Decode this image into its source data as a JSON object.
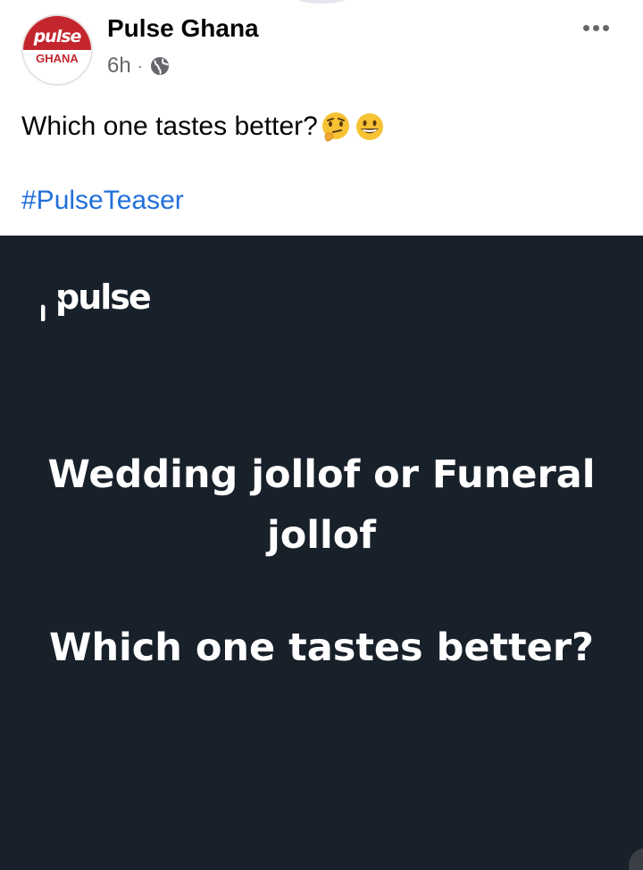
{
  "post": {
    "author": "Pulse Ghana",
    "avatar": {
      "brand": "pulse",
      "sub": "GHANA"
    },
    "time": "6h",
    "separator": "·",
    "audience_icon": "globe-icon",
    "more_icon": "more-options-icon",
    "text": "Which one tastes better?",
    "emojis": [
      "thinking-face-emoji",
      "grinning-face-emoji"
    ],
    "hashtag": "#PulseTeaser"
  },
  "image": {
    "logo": "pulse",
    "headline": "Wedding jollof or Funeral jollof",
    "question": "Which one tastes better?"
  },
  "colors": {
    "brand_red": "#c4262e",
    "image_bg": "#18202a",
    "link_blue": "#216fdb",
    "meta_gray": "#65676b"
  }
}
